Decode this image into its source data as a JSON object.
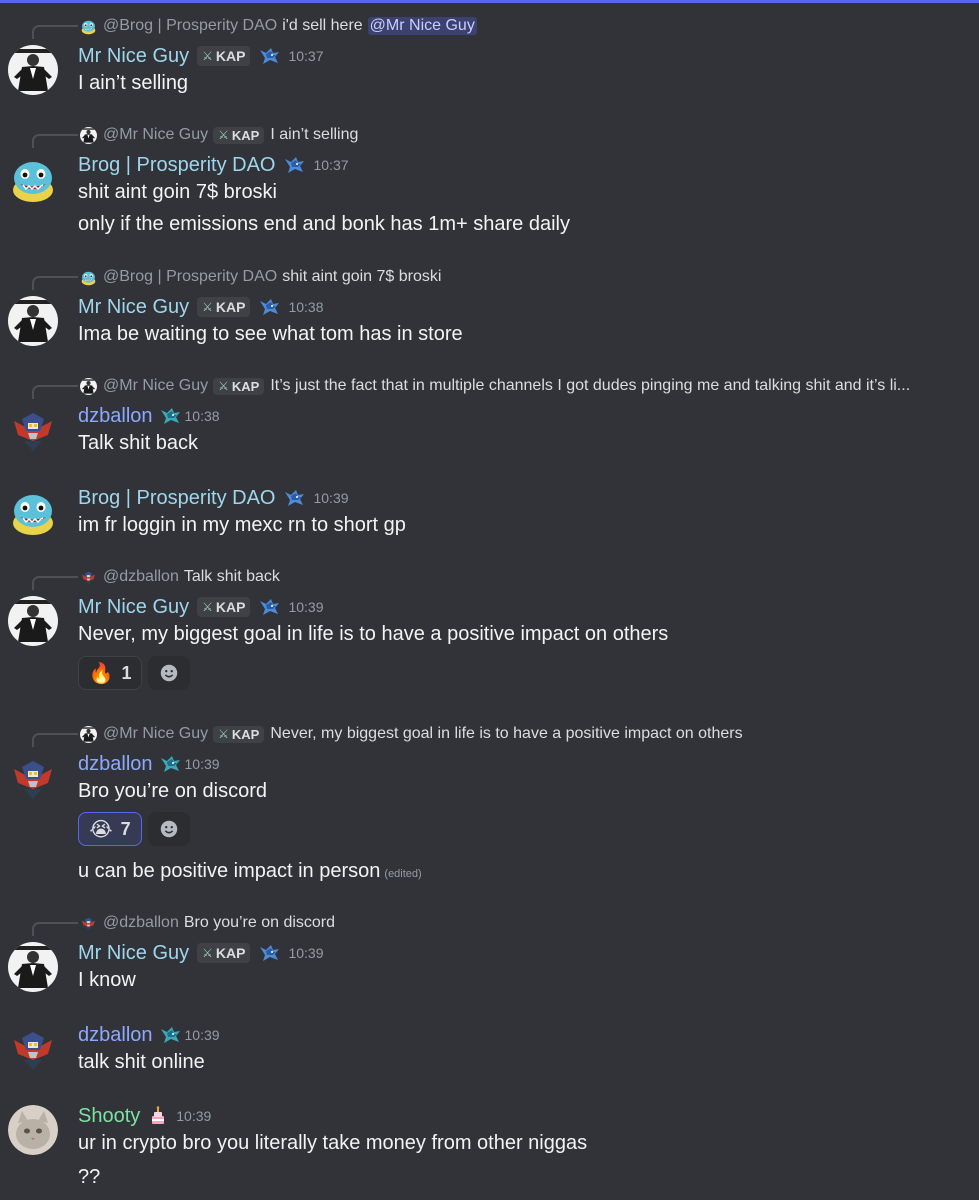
{
  "users": {
    "nice": "Mr Nice Guy",
    "brog": "Brog | Prosperity DAO",
    "dz": "dzballon",
    "shooty": "Shooty"
  },
  "mentions": {
    "nice": "@Mr Nice Guy",
    "brog": "@Brog | Prosperity DAO",
    "dz": "@dzballon"
  },
  "tag": "KAP",
  "messages": [
    {
      "reply_to": "@Brog | Prosperity DAO",
      "reply_text": "i'd sell here",
      "reply_mention": "@Mr Nice Guy",
      "author": "Mr Nice Guy",
      "time": "10:37",
      "lines": [
        "I ain’t selling"
      ]
    },
    {
      "reply_to": "@Mr Nice Guy",
      "reply_text": "I ain’t selling",
      "author": "Brog | Prosperity DAO",
      "time": "10:37",
      "lines": [
        "shit aint goin 7$ broski",
        "only if the emissions end and bonk has 1m+ share daily"
      ]
    },
    {
      "reply_to": "@Brog | Prosperity DAO",
      "reply_text": "shit aint goin 7$ broski",
      "author": "Mr Nice Guy",
      "time": "10:38",
      "lines": [
        "Ima be waiting to see what tom has in store"
      ]
    },
    {
      "reply_to": "@Mr Nice Guy",
      "reply_text": "It’s just the fact that in multiple channels I got dudes pinging me and talking shit and it’s li...",
      "author": "dzballon",
      "time": "10:38",
      "lines": [
        "Talk shit back"
      ]
    },
    {
      "author": "Brog | Prosperity DAO",
      "time": "10:39",
      "lines": [
        "im fr loggin in my mexc rn to short gp"
      ]
    },
    {
      "reply_to": "@dzballon",
      "reply_text": "Talk shit back",
      "author": "Mr Nice Guy",
      "time": "10:39",
      "lines": [
        "Never, my biggest goal in life is to have a positive impact on others"
      ],
      "reaction": {
        "emoji": "🔥",
        "count": "1"
      }
    },
    {
      "reply_to": "@Mr Nice Guy",
      "reply_text": "Never, my biggest goal in life is to have a positive impact on others",
      "author": "dzballon",
      "time": "10:39",
      "lines": [
        "Bro you’re on discord",
        "u can be positive impact in person"
      ],
      "edited": "(edited)",
      "reaction": {
        "emoji": "😭",
        "count": "7"
      }
    },
    {
      "reply_to": "@dzballon",
      "reply_text": "Bro you’re on discord",
      "author": "Mr Nice Guy",
      "time": "10:39",
      "lines": [
        "I know"
      ]
    },
    {
      "author": "dzballon",
      "time": "10:39",
      "lines": [
        "talk shit online"
      ]
    },
    {
      "author": "Shooty",
      "time": "10:39",
      "lines": [
        "ur in crypto bro you literally take money from other niggas",
        "??"
      ],
      "badge_icon": "cake-icon"
    }
  ],
  "colors": {
    "background": "#313338",
    "accent": "#5865f2",
    "name_nice": "#9fd6ec",
    "name_dz": "#8da9ff",
    "name_shooty": "#7ee2a2"
  }
}
